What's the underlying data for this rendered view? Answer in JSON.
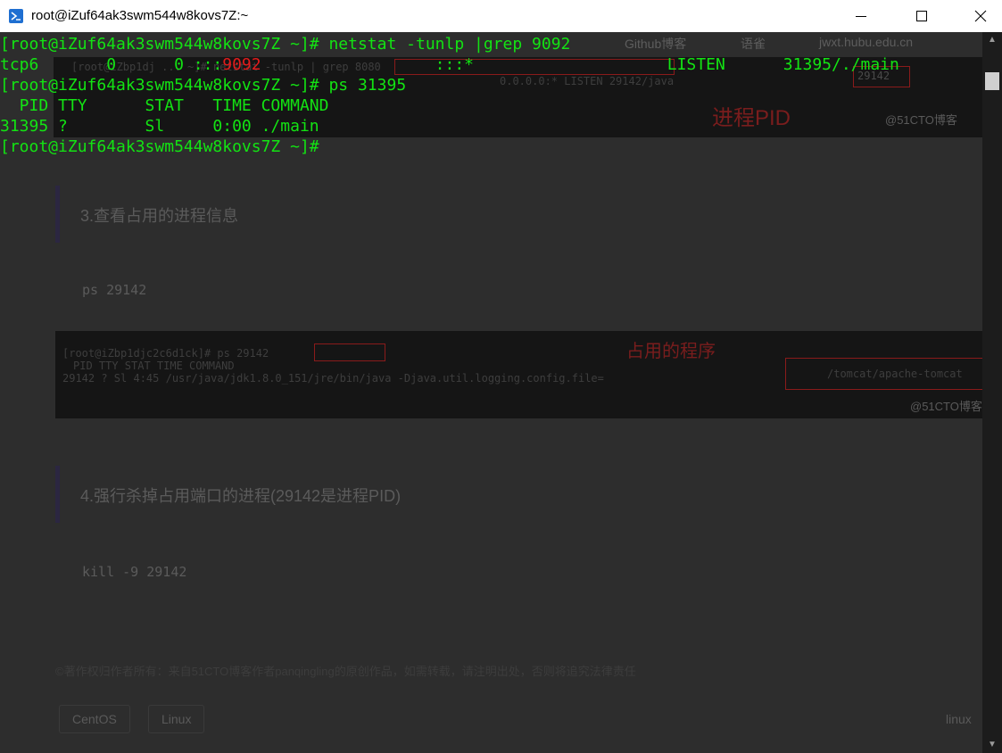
{
  "window": {
    "title": "root@iZuf64ak3swm544w8kovs7Z:~"
  },
  "background": {
    "tabs": [
      "Github博客",
      "语雀",
      "jwxt.hubu.edu.cn"
    ],
    "annotation_pid": "进程PID",
    "annotation_program": "占用的程序",
    "watermark": "@51CTO博客",
    "shot1_lines": [
      "[root@iZbp1dj ... ~]# netstat -tunlp | grep 8080",
      "0.0.0.0:*        LISTEN   29142/java"
    ],
    "shot1_pid": "29142",
    "shot2_lines": [
      "[root@iZbp1djc2c6d1ck]# ps 29142",
      "PID TTY   STAT  TIME COMMAND",
      "29142 ?   Sl    4:45 /usr/java/jdk1.8.0_151/jre/bin/java -Djava.util.logging.config.file=",
      "/tomcat/apache-tomcat"
    ],
    "heading_3": "3.查看占用的进程信息",
    "code_3": "ps 29142",
    "heading_4": "4.强行杀掉占用端口的进程(29142是进程PID)",
    "code_4": "kill -9 29142",
    "copyright": "©著作权归作者所有：来自51CTO博客作者panqingling的原创作品，如需转载，请注明出处，否则将追究法律责任",
    "tags": [
      "CentOS",
      "Linux"
    ],
    "side_tag": "linux"
  },
  "terminal": {
    "lines": [
      {
        "segments": [
          {
            "text": "[root@iZuf64ak3swm544w8kovs7Z ~]# netstat -tunlp |grep 9092",
            "color": "#13e313"
          }
        ]
      },
      {
        "segments": [
          {
            "text": "tcp6       0      0 :::",
            "color": "#13e313"
          },
          {
            "text": "9092",
            "color": "#e31b1b"
          },
          {
            "text": "                  :::*                    LISTEN      31395/./main",
            "color": "#13e313"
          }
        ]
      },
      {
        "segments": [
          {
            "text": "[root@iZuf64ak3swm544w8kovs7Z ~]# ps 31395",
            "color": "#13e313"
          }
        ]
      },
      {
        "segments": [
          {
            "text": "  PID TTY      STAT   TIME COMMAND",
            "color": "#13e313"
          }
        ]
      },
      {
        "segments": [
          {
            "text": "31395 ?        Sl     0:00 ./main",
            "color": "#13e313"
          }
        ]
      },
      {
        "segments": [
          {
            "text": "[root@iZuf64ak3swm544w8kovs7Z ~]#",
            "color": "#13e313"
          }
        ]
      }
    ]
  },
  "colors": {
    "prompt_green": "#13e313",
    "highlight_red": "#e31b1b",
    "terminal_bg": "#2a2a2a"
  },
  "icons": {
    "app": "powershell-icon",
    "minimize": "minimize-icon",
    "maximize": "maximize-icon",
    "close": "close-icon"
  }
}
